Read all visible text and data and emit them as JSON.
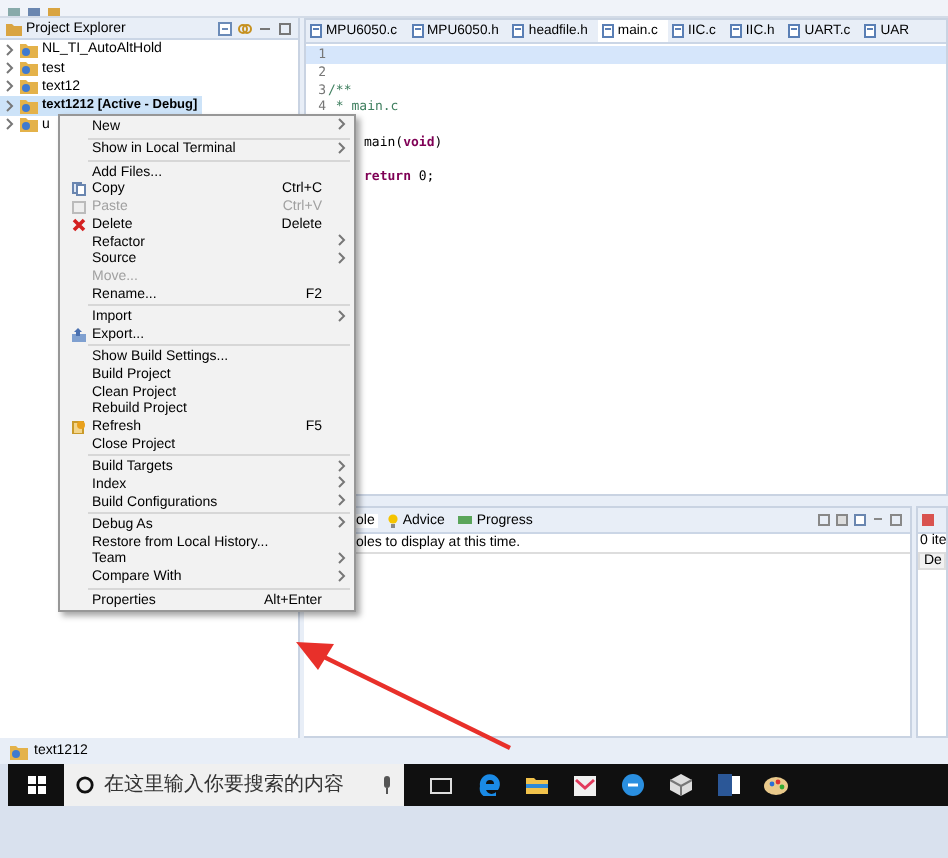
{
  "project_explorer": {
    "title": "Project Explorer",
    "items": [
      {
        "label": "NL_TI_AutoAltHold",
        "selected": false
      },
      {
        "label": "test",
        "selected": false
      },
      {
        "label": "text12",
        "selected": false
      },
      {
        "label": "text1212 [Active - Debug]",
        "selected": true
      },
      {
        "label": "u",
        "selected": false
      }
    ]
  },
  "editor": {
    "tabs": [
      {
        "label": "MPU6050.c",
        "selected": false
      },
      {
        "label": "MPU6050.h",
        "selected": false
      },
      {
        "label": "headfile.h",
        "selected": false
      },
      {
        "label": "main.c",
        "selected": true
      },
      {
        "label": "IIC.c",
        "selected": false
      },
      {
        "label": "IIC.h",
        "selected": false
      },
      {
        "label": "UART.c",
        "selected": false
      },
      {
        "label": "UAR",
        "selected": false
      }
    ],
    "lines": [
      {
        "number": "1",
        "current": true
      },
      {
        "number": "2",
        "current": false
      },
      {
        "number": "3",
        "text": "/**",
        "kind": "comment",
        "current": false
      },
      {
        "number": "4",
        "text": " * main.c",
        "kind": "comment",
        "current": false
      },
      {
        "current": false
      },
      {
        "text": "main(**void**)",
        "current": false
      },
      {
        "current": false
      },
      {
        "text": "**return** 0;",
        "current": false
      }
    ]
  },
  "context_menu": {
    "items": [
      {
        "kind": "item",
        "label": "New",
        "submenu": true
      },
      {
        "kind": "separator"
      },
      {
        "kind": "item",
        "label": "Show in Local Terminal",
        "submenu": true
      },
      {
        "kind": "separator"
      },
      {
        "kind": "item",
        "label": "Add Files..."
      },
      {
        "kind": "item",
        "label": "Copy",
        "shortcut": "Ctrl+C"
      },
      {
        "kind": "item",
        "label": "Paste",
        "shortcut": "Ctrl+V",
        "disabled": true
      },
      {
        "kind": "item",
        "label": "Delete",
        "shortcut": "Delete"
      },
      {
        "kind": "item",
        "label": "Refactor",
        "submenu": true
      },
      {
        "kind": "item",
        "label": "Source",
        "submenu": true
      },
      {
        "kind": "item",
        "label": "Move...",
        "disabled": true
      },
      {
        "kind": "item",
        "label": "Rename...",
        "shortcut": "F2"
      },
      {
        "kind": "separator"
      },
      {
        "kind": "item",
        "label": "Import",
        "submenu": true
      },
      {
        "kind": "item",
        "label": "Export..."
      },
      {
        "kind": "separator"
      },
      {
        "kind": "item",
        "label": "Show Build Settings..."
      },
      {
        "kind": "item",
        "label": "Build Project"
      },
      {
        "kind": "item",
        "label": "Clean Project"
      },
      {
        "kind": "item",
        "label": "Rebuild Project"
      },
      {
        "kind": "item",
        "label": "Refresh",
        "shortcut": "F5"
      },
      {
        "kind": "item",
        "label": "Close Project"
      },
      {
        "kind": "separator"
      },
      {
        "kind": "item",
        "label": "Build Targets",
        "submenu": true
      },
      {
        "kind": "item",
        "label": "Index",
        "submenu": true
      },
      {
        "kind": "item",
        "label": "Build Configurations",
        "submenu": true
      },
      {
        "kind": "separator"
      },
      {
        "kind": "item",
        "label": "Debug As",
        "submenu": true
      },
      {
        "kind": "item",
        "label": "Restore from Local History..."
      },
      {
        "kind": "item",
        "label": "Team",
        "submenu": true
      },
      {
        "kind": "item",
        "label": "Compare With",
        "submenu": true
      },
      {
        "kind": "separator"
      },
      {
        "kind": "item",
        "label": "Properties",
        "shortcut": "Alt+Enter"
      }
    ]
  },
  "console": {
    "tabs": [
      {
        "label": "ole",
        "selected": true
      },
      {
        "label": "Advice",
        "selected": false
      },
      {
        "label": "Progress",
        "selected": false
      }
    ],
    "message": "oles to display at this time."
  },
  "side_panel": {
    "count": "0 ite",
    "column_1": "De"
  },
  "status_bar": {
    "text": "text1212"
  },
  "taskbar": {
    "search": {
      "placeholder": "在这里输入你要搜索的内容"
    }
  }
}
